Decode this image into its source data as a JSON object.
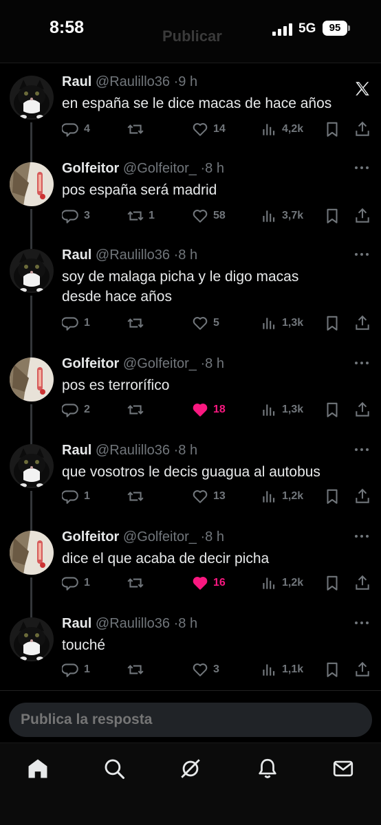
{
  "status_bar": {
    "time": "8:58",
    "network": "5G",
    "battery": "95",
    "header_ghost": "Publicar"
  },
  "colors": {
    "background": "#000000",
    "text_primary": "#e7e9ea",
    "text_secondary": "#71767b",
    "like_active": "#f91880",
    "thread_line": "#333639"
  },
  "tweets": [
    {
      "name": "Raul",
      "handle": "@Raulillo36",
      "sep": "·",
      "time": "9 h",
      "lines": [
        "en españa se le dice macas de hace años"
      ],
      "replies": "4",
      "retweets": "",
      "likes": "14",
      "views": "4,2k",
      "liked": false,
      "corner": "x-logo-icon"
    },
    {
      "name": "Golfeitor",
      "handle": "@Golfeitor_",
      "sep": "·",
      "time": "8 h",
      "lines": [
        "pos españa será madrid"
      ],
      "replies": "3",
      "retweets": "1",
      "likes": "58",
      "views": "3,7k",
      "liked": false,
      "corner": "more-icon"
    },
    {
      "name": "Raul",
      "handle": "@Raulillo36",
      "sep": "·",
      "time": "8 h",
      "lines": [
        "soy de malaga picha y le digo macas",
        "desde hace años"
      ],
      "replies": "1",
      "retweets": "",
      "likes": "5",
      "views": "1,3k",
      "liked": false,
      "corner": "more-icon"
    },
    {
      "name": "Golfeitor",
      "handle": "@Golfeitor_",
      "sep": "·",
      "time": "8 h",
      "lines": [
        "pos es terrorífico"
      ],
      "replies": "2",
      "retweets": "",
      "likes": "18",
      "views": "1,3k",
      "liked": true,
      "corner": "more-icon"
    },
    {
      "name": "Raul",
      "handle": "@Raulillo36",
      "sep": "·",
      "time": "8 h",
      "lines": [
        "que vosotros le decis guagua al autobus"
      ],
      "replies": "1",
      "retweets": "",
      "likes": "13",
      "views": "1,2k",
      "liked": false,
      "corner": "more-icon"
    },
    {
      "name": "Golfeitor",
      "handle": "@Golfeitor_",
      "sep": "·",
      "time": "8 h",
      "lines": [
        "dice el que acaba de decir picha"
      ],
      "replies": "1",
      "retweets": "",
      "likes": "16",
      "views": "1,2k",
      "liked": true,
      "corner": "more-icon"
    },
    {
      "name": "Raul",
      "handle": "@Raulillo36",
      "sep": "·",
      "time": "8 h",
      "lines": [
        "touché"
      ],
      "replies": "1",
      "retweets": "",
      "likes": "3",
      "views": "1,1k",
      "liked": false,
      "corner": "more-icon"
    }
  ],
  "compose": {
    "placeholder": "Publica la resposta"
  },
  "tabbar": {
    "items": [
      "home-icon",
      "search-icon",
      "grok-icon",
      "notifications-icon",
      "messages-icon"
    ]
  }
}
